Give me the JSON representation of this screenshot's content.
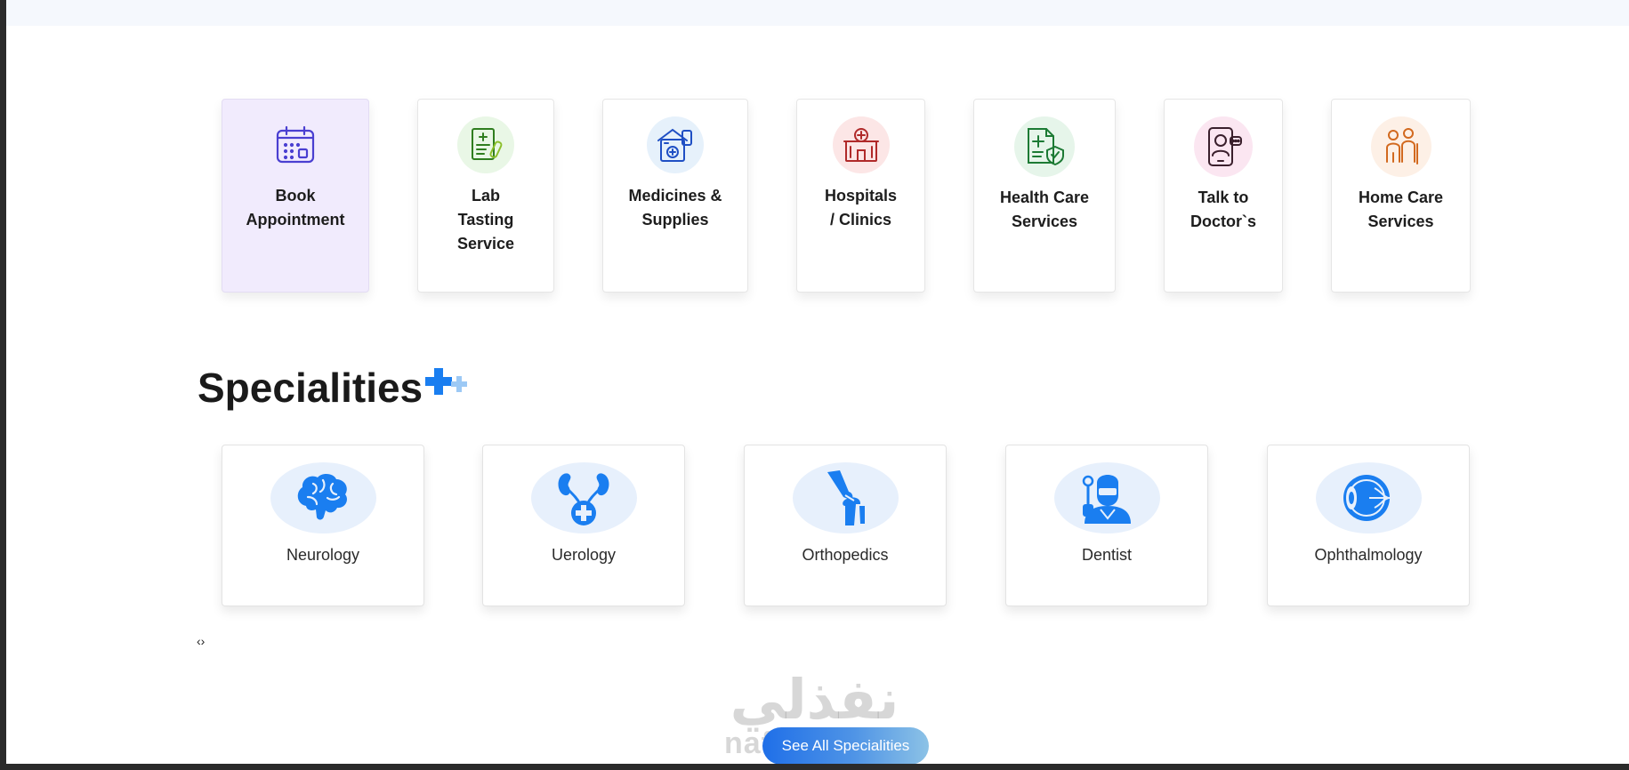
{
  "services": [
    {
      "label": "Book Appointment",
      "icon": "calendar-icon",
      "bg": "transparent",
      "active": true
    },
    {
      "label": "Lab Tasting Service",
      "icon": "lab-report-icon",
      "bg": "#e9f7e6",
      "active": false
    },
    {
      "label": "Medicines & Supplies",
      "icon": "pharmacy-icon",
      "bg": "#e6f1fb",
      "active": false
    },
    {
      "label": "Hospitals / Clinics",
      "icon": "hospital-icon",
      "bg": "#fce6e6",
      "active": false
    },
    {
      "label": "Health Care Services",
      "icon": "health-insurance-icon",
      "bg": "#e6f5ea",
      "active": false
    },
    {
      "label": "Talk to Doctor`s",
      "icon": "video-call-doctor-icon",
      "bg": "#fbe6f1",
      "active": false
    },
    {
      "label": "Home Care Services",
      "icon": "elderly-care-icon",
      "bg": "#fdf0e6",
      "active": false
    }
  ],
  "specialities": {
    "title": "Specialities",
    "items": [
      {
        "label": "Neurology",
        "icon": "brain-icon"
      },
      {
        "label": "Uerology",
        "icon": "kidney-icon"
      },
      {
        "label": "Orthopedics",
        "icon": "knee-joint-icon"
      },
      {
        "label": "Dentist",
        "icon": "dentist-icon"
      },
      {
        "label": "Ophthalmology",
        "icon": "eye-icon"
      }
    ],
    "arrows": "‹›",
    "see_all_label": "See All Specialities"
  },
  "watermark": {
    "arabic": "نفذلي",
    "latin": "nafezly.com"
  },
  "colors": {
    "accent": "#1a7ef0",
    "active_card": "#f1ebfd",
    "speciality_icon_bg": "#e7f0fc"
  }
}
